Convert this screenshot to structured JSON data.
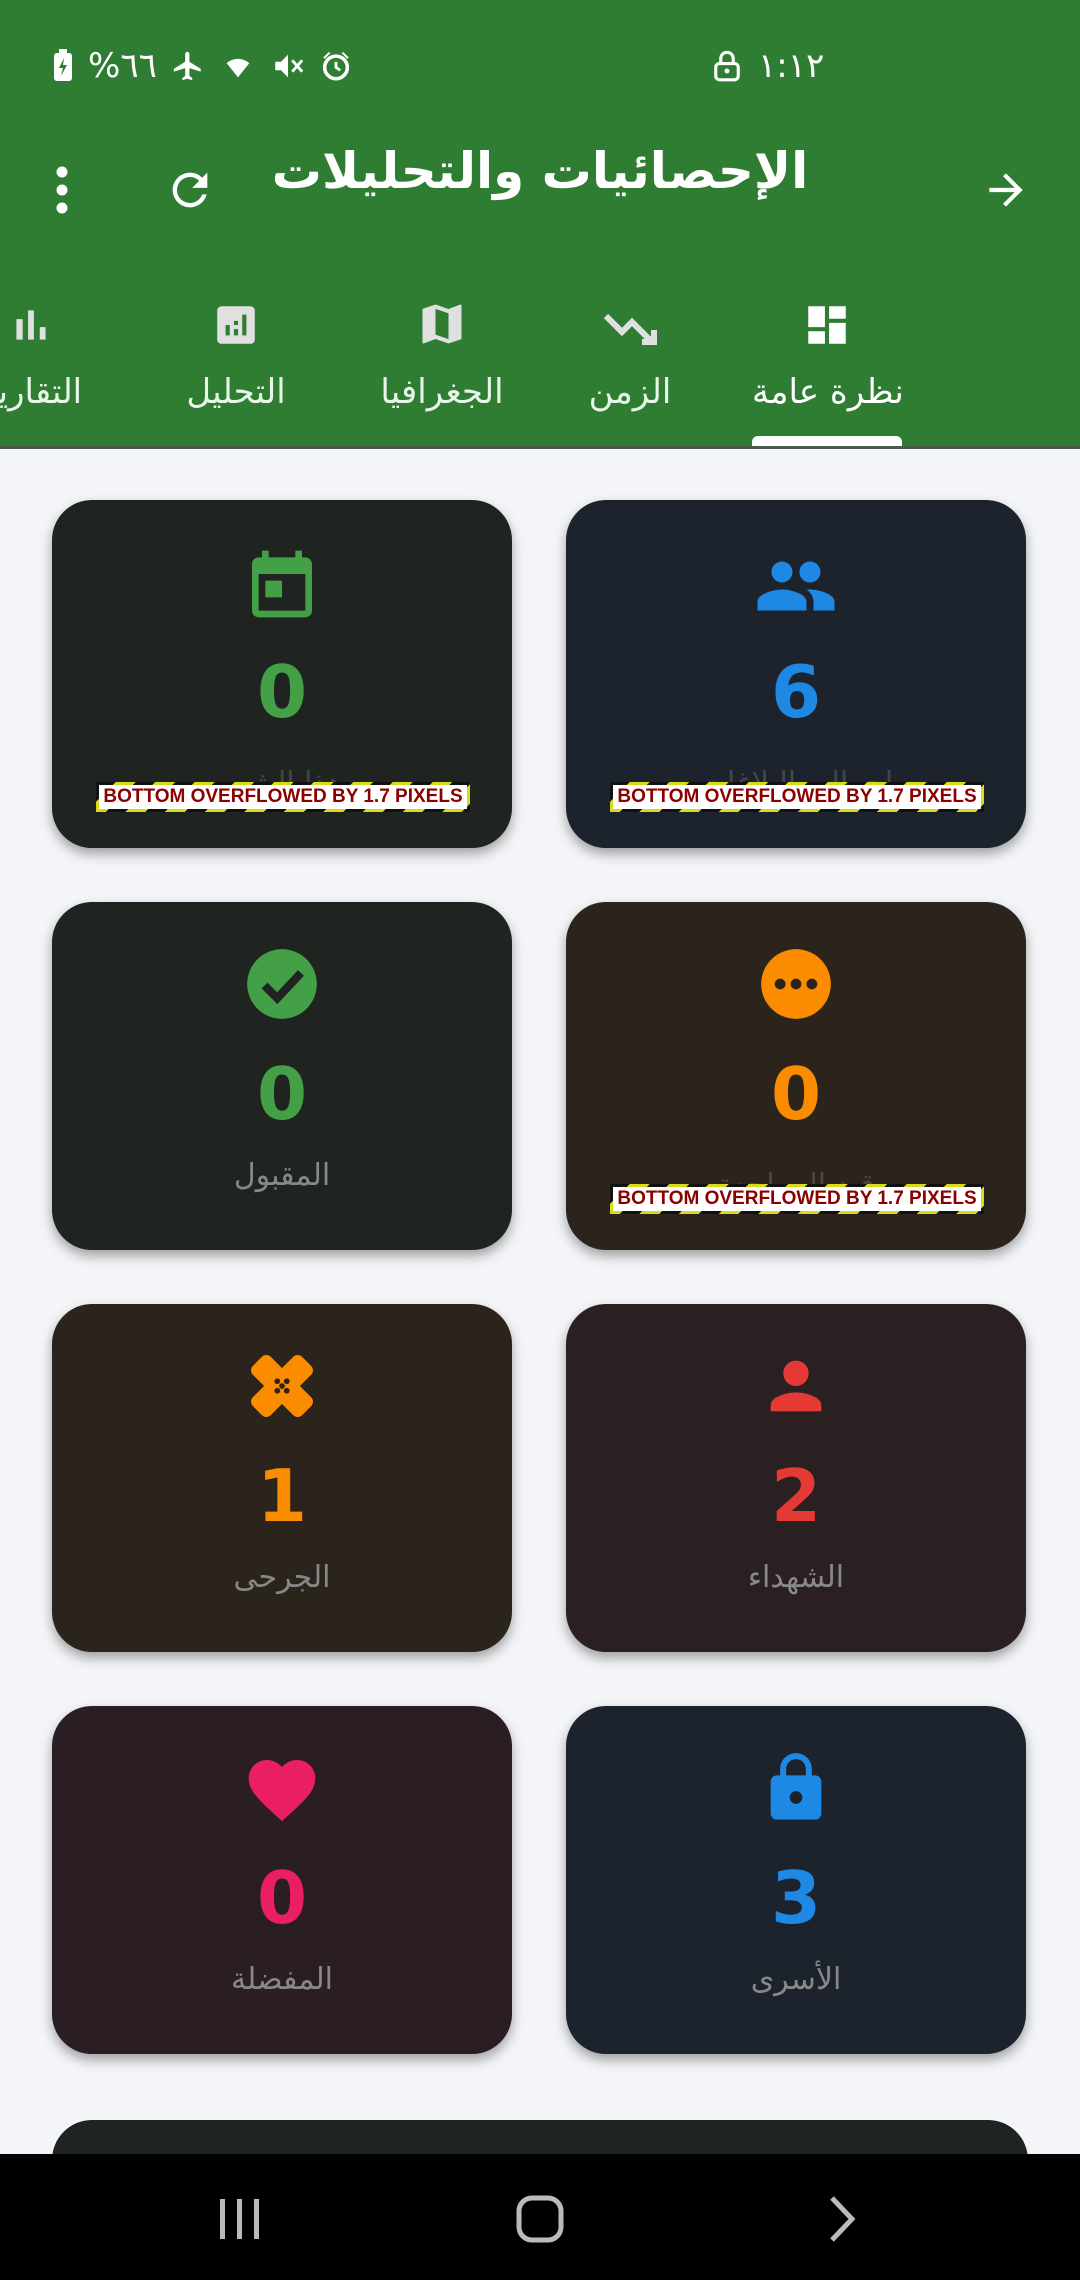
{
  "status_bar": {
    "battery_text": "%٦٦",
    "time": "١:١٢"
  },
  "app_bar": {
    "title": "الإحصائيات والتحليلات",
    "icons": [
      "arrow-forward-icon",
      "refresh-icon",
      "more-vert-icon"
    ]
  },
  "tabs": [
    {
      "label": "نظرة عامة",
      "icon": "dashboard-icon",
      "selected": true
    },
    {
      "label": "الزمن",
      "icon": "trending-icon",
      "selected": false
    },
    {
      "label": "الجغرافيا",
      "icon": "map-icon",
      "selected": false
    },
    {
      "label": "التحليل",
      "icon": "analytics-icon",
      "selected": false
    },
    {
      "label": "التقارير",
      "icon": "bar-chart-icon",
      "selected": false
    }
  ],
  "cards": [
    {
      "id": "total-reports",
      "value": "6",
      "label": "إجمالي البلاغات",
      "icon": "people-icon",
      "color": "#1e88e5",
      "bg": "#1d232d",
      "overflow": true
    },
    {
      "id": "this-month",
      "value": "0",
      "label": "هذا الشهر",
      "icon": "calendar-icon",
      "color": "#43a047",
      "bg": "#1f2420",
      "overflow": true
    },
    {
      "id": "pending",
      "value": "0",
      "label": "قيد المراجعة",
      "icon": "more-circle-icon",
      "color": "#fb8c00",
      "bg": "#2b241d",
      "overflow": true
    },
    {
      "id": "accepted",
      "value": "0",
      "label": "المقبول",
      "icon": "check-circle-icon",
      "color": "#43a047",
      "bg": "#1f2420",
      "overflow": false
    },
    {
      "id": "martyrs",
      "value": "2",
      "label": "الشهداء",
      "icon": "person-icon",
      "color": "#e53935",
      "bg": "#2a1f21",
      "overflow": false
    },
    {
      "id": "wounded",
      "value": "1",
      "label": "الجرحى",
      "icon": "bandage-icon",
      "color": "#fb8c00",
      "bg": "#2b241d",
      "overflow": false
    },
    {
      "id": "prisoners",
      "value": "3",
      "label": "الأسرى",
      "icon": "lock-icon",
      "color": "#1e88e5",
      "bg": "#1d232d",
      "overflow": false
    },
    {
      "id": "favorites",
      "value": "0",
      "label": "المفضلة",
      "icon": "heart-icon",
      "color": "#e91e63",
      "bg": "#2a1d24",
      "overflow": false
    }
  ],
  "overflow_message": "BOTTOM OVERFLOWED BY 1.7 PIXELS",
  "nav_bar": [
    "recents-icon",
    "home-icon",
    "back-icon"
  ]
}
